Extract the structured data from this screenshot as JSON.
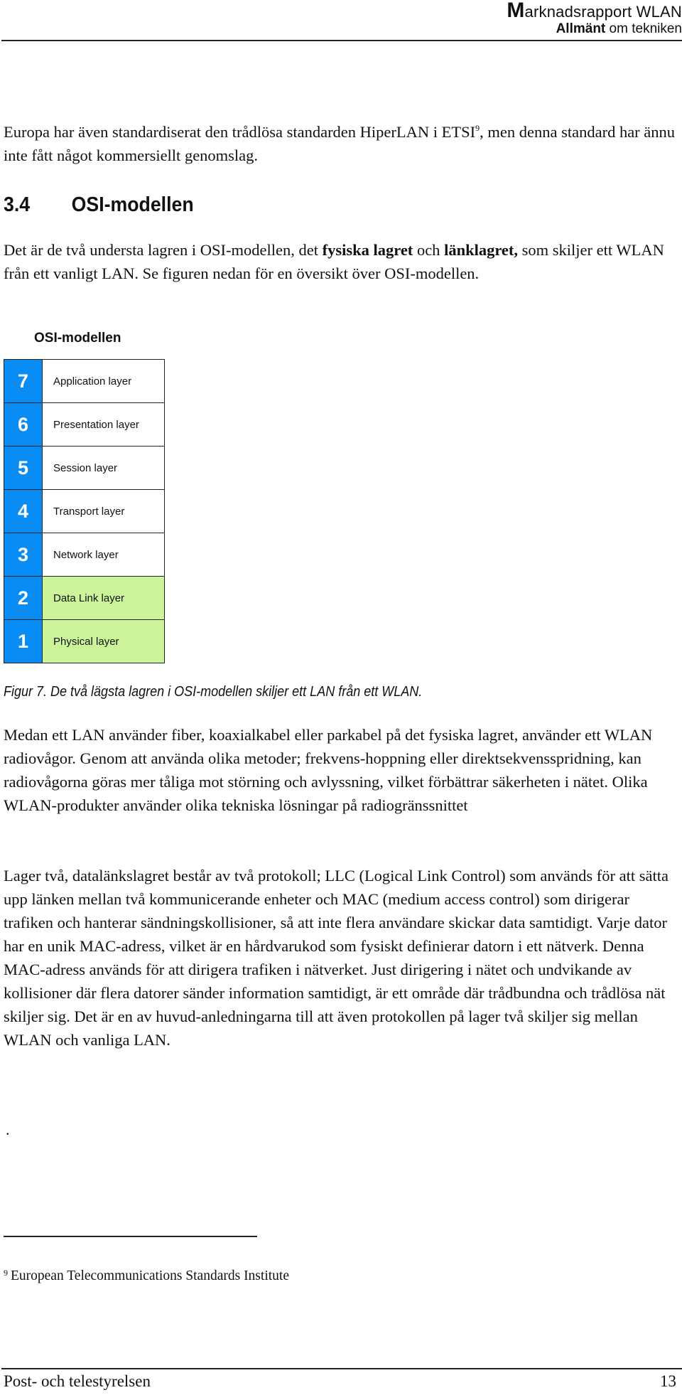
{
  "header": {
    "title_initial": "M",
    "title_rest": "arknadsrapport WLAN",
    "subtitle_bold": "Allmänt",
    "subtitle_rest": " om tekniken"
  },
  "intro_paragraph": {
    "text_before_ref": "Europa har även standardiserat den trådlösa standarden HiperLAN i ETSI",
    "ref": "9",
    "text_after_ref": ", men denna standard har ännu inte fått något kommersiellt genomslag."
  },
  "section": {
    "number": "3.4",
    "title": "OSI-modellen"
  },
  "section_paragraph": {
    "part1": "Det är de två understa lagren i OSI-modellen, det ",
    "bold1": "fysiska lagret",
    "part2": " och ",
    "bold2": "länklagret,",
    "part3": " som skiljer ett WLAN från ett vanligt LAN. Se figuren nedan för en översikt över OSI-modellen."
  },
  "figure": {
    "title": "OSI-modellen",
    "layers": [
      {
        "number": "7",
        "label": "Application layer",
        "highlighted": false
      },
      {
        "number": "6",
        "label": "Presentation layer",
        "highlighted": false
      },
      {
        "number": "5",
        "label": "Session layer",
        "highlighted": false
      },
      {
        "number": "4",
        "label": "Transport layer",
        "highlighted": false
      },
      {
        "number": "3",
        "label": "Network layer",
        "highlighted": false
      },
      {
        "number": "2",
        "label": "Data Link layer",
        "highlighted": true
      },
      {
        "number": "1",
        "label": "Physical layer",
        "highlighted": true
      }
    ],
    "colors": {
      "number_bg": "#0a8cf5",
      "highlight_bg": "#ccf59a"
    },
    "caption": "Figur 7. De två lägsta lagren i OSI-modellen skiljer ett LAN från ett WLAN."
  },
  "paragraph_radio": "Medan ett LAN använder fiber, koaxialkabel eller parkabel på det fysiska lagret, använder ett WLAN radiovågor. Genom att använda olika metoder; frekvens-hoppning eller direktsekvensspridning, kan radiovågorna göras mer tåliga mot störning och avlyssning, vilket förbättrar säkerheten i nätet. Olika WLAN-produkter använder olika tekniska lösningar på radiogränssnittet",
  "paragraph_layer2": "Lager två, datalänkslagret består av två protokoll; LLC (Logical Link Control) som används för att sätta upp länken mellan två kommunicerande enheter och MAC (medium access control) som dirigerar trafiken och hanterar sändningskollisioner, så att inte flera användare skickar data samtidigt. Varje dator har en unik MAC-adress, vilket är en hårdvarukod som fysiskt definierar datorn i ett nätverk. Denna MAC-adress används för att dirigera trafiken i nätverket. Just dirigering i nätet och undvikande av kollisioner där flera datorer sänder information samtidigt, är ett område där trådbundna och trådlösa nät skiljer sig. Det är en av huvud-anledningarna till att även protokollen på lager två skiljer sig mellan WLAN och vanliga LAN.",
  "stray_dot": ".",
  "footnote": {
    "ref": "9",
    "text": "European Telecommunications Standards Institute"
  },
  "footer": {
    "publisher": "Post- och telestyrelsen",
    "page_number": "13"
  }
}
